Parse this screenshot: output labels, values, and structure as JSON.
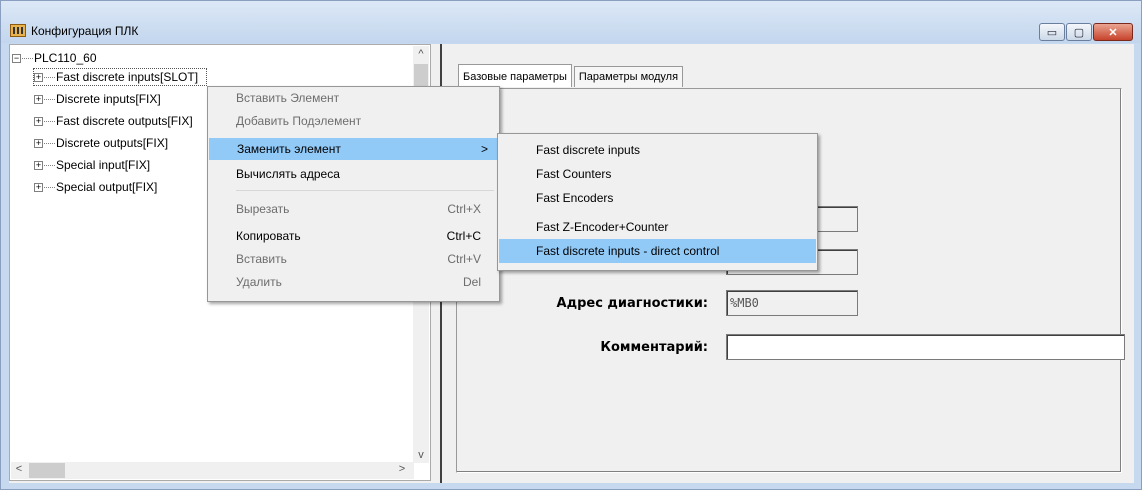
{
  "window": {
    "title": "Конфигурация ПЛК",
    "icon": "plc-config-icon",
    "buttons": {
      "minimize": "▭",
      "maximize": "▢",
      "close": "✕"
    }
  },
  "tree": {
    "root": "PLC110_60",
    "root_toggle": "−",
    "items": [
      {
        "label": "Fast discrete inputs[SLOT]",
        "toggle": "+"
      },
      {
        "label": "Discrete inputs[FIX]",
        "toggle": "+"
      },
      {
        "label": "Fast discrete outputs[FIX]",
        "toggle": "+"
      },
      {
        "label": "Discrete outputs[FIX]",
        "toggle": "+"
      },
      {
        "label": "Special input[FIX]",
        "toggle": "+"
      },
      {
        "label": "Special output[FIX]",
        "toggle": "+"
      }
    ],
    "scroll_up": "^",
    "scroll_down": "v",
    "scroll_left": "<",
    "scroll_right": ">"
  },
  "tabs": [
    {
      "label": "Базовые параметры"
    },
    {
      "label": "Параметры модуля"
    }
  ],
  "form": {
    "diag_address_label": "Адрес диагностики:",
    "diag_address_value": "%MB0",
    "comment_label": "Комментарий:",
    "comment_value": ""
  },
  "context_menu": {
    "items": [
      {
        "label": "Вставить Элемент",
        "shortcut": "",
        "enabled": false
      },
      {
        "label": "Добавить Подэлемент",
        "shortcut": "",
        "enabled": false
      },
      {
        "label": "Заменить элемент",
        "shortcut": ">",
        "enabled": true,
        "highlighted": true
      },
      {
        "label": "Вычислять адреса",
        "shortcut": "",
        "enabled": true
      },
      {
        "label": "Вырезать",
        "shortcut": "Ctrl+X",
        "enabled": false
      },
      {
        "label": "Копировать",
        "shortcut": "Ctrl+C",
        "enabled": true
      },
      {
        "label": "Вставить",
        "shortcut": "Ctrl+V",
        "enabled": false
      },
      {
        "label": "Удалить",
        "shortcut": "Del",
        "enabled": false
      }
    ]
  },
  "submenu": {
    "items": [
      {
        "label": "Fast discrete inputs"
      },
      {
        "label": "Fast Counters"
      },
      {
        "label": "Fast Encoders"
      },
      {
        "label": "Fast Z-Encoder+Counter"
      },
      {
        "label": "Fast discrete inputs - direct control",
        "highlighted": true
      }
    ]
  },
  "colors": {
    "highlight": "#91c9f7",
    "titlebar": "#c7d9ee"
  }
}
